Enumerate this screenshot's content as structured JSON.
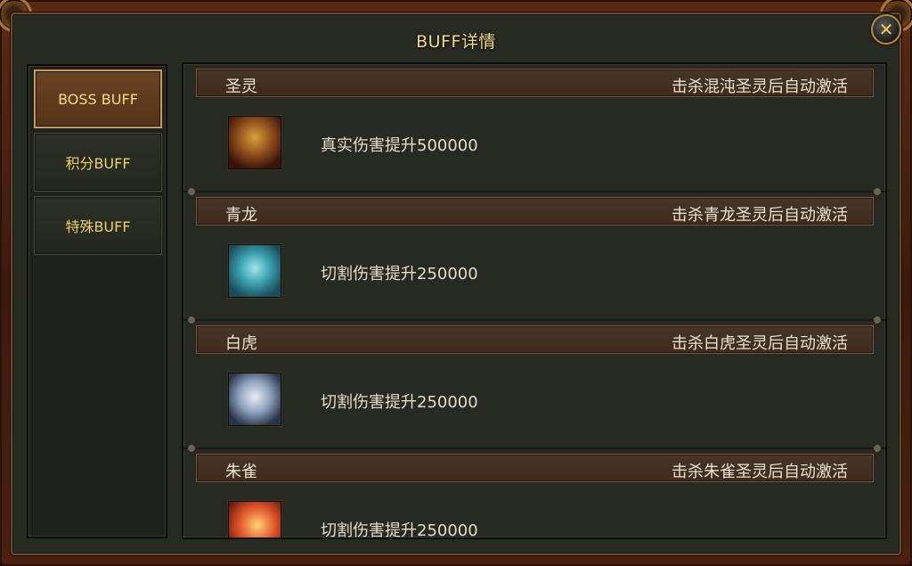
{
  "window": {
    "title": "BUFF详情",
    "close_icon": "close-icon"
  },
  "sidebar": {
    "items": [
      {
        "label": "BOSS BUFF",
        "active": true
      },
      {
        "label": "积分BUFF",
        "active": false
      },
      {
        "label": "特殊BUFF",
        "active": false
      }
    ]
  },
  "buffs": [
    {
      "name": "圣灵",
      "condition": "击杀混沌圣灵后自动激活",
      "effect": "真实伤害提升500000",
      "icon": "golden-beast-icon"
    },
    {
      "name": "青龙",
      "condition": "击杀青龙圣灵后自动激活",
      "effect": "切割伤害提升250000",
      "icon": "azure-dragon-icon"
    },
    {
      "name": "白虎",
      "condition": "击杀白虎圣灵后自动激活",
      "effect": "切割伤害提升250000",
      "icon": "white-tiger-icon"
    },
    {
      "name": "朱雀",
      "condition": "击杀朱雀圣灵后自动激活",
      "effect": "切割伤害提升250000",
      "icon": "vermilion-bird-icon"
    }
  ],
  "colors": {
    "title": "#f2d88a",
    "sidebar_text": "#e7cf6a",
    "active_tab": "#6b4322",
    "panel_bg": "#272a22"
  }
}
